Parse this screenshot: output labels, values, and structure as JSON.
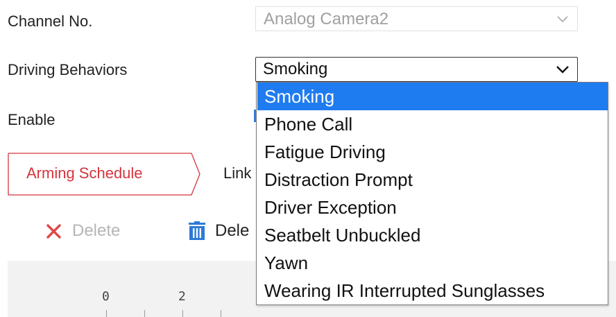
{
  "form": {
    "channel_label": "Channel No.",
    "channel_value": "Analog Camera2",
    "driving_label": "Driving Behaviors",
    "driving_value": "Smoking",
    "enable_label": "Enable"
  },
  "tabs": [
    {
      "label": "Arming Schedule",
      "active": true
    },
    {
      "label": "Link",
      "active": false
    }
  ],
  "toolbar": {
    "delete_label": "Delete",
    "delete_icon": "x-icon",
    "delete_all_label": "Dele",
    "delete_all_icon": "trash-icon"
  },
  "timeline": {
    "tick_labels": [
      "0",
      "2"
    ]
  },
  "dropdown": {
    "options": [
      "Smoking",
      "Phone Call",
      "Fatigue Driving",
      "Distraction Prompt",
      "Driver Exception",
      "Seatbelt Unbuckled",
      "Yawn",
      "Wearing IR Interrupted Sunglasses"
    ],
    "selected": "Smoking"
  },
  "colors": {
    "accent_red": "#d4353d",
    "selection_blue": "#1f7cf0",
    "icon_blue": "#2d7ad6"
  }
}
